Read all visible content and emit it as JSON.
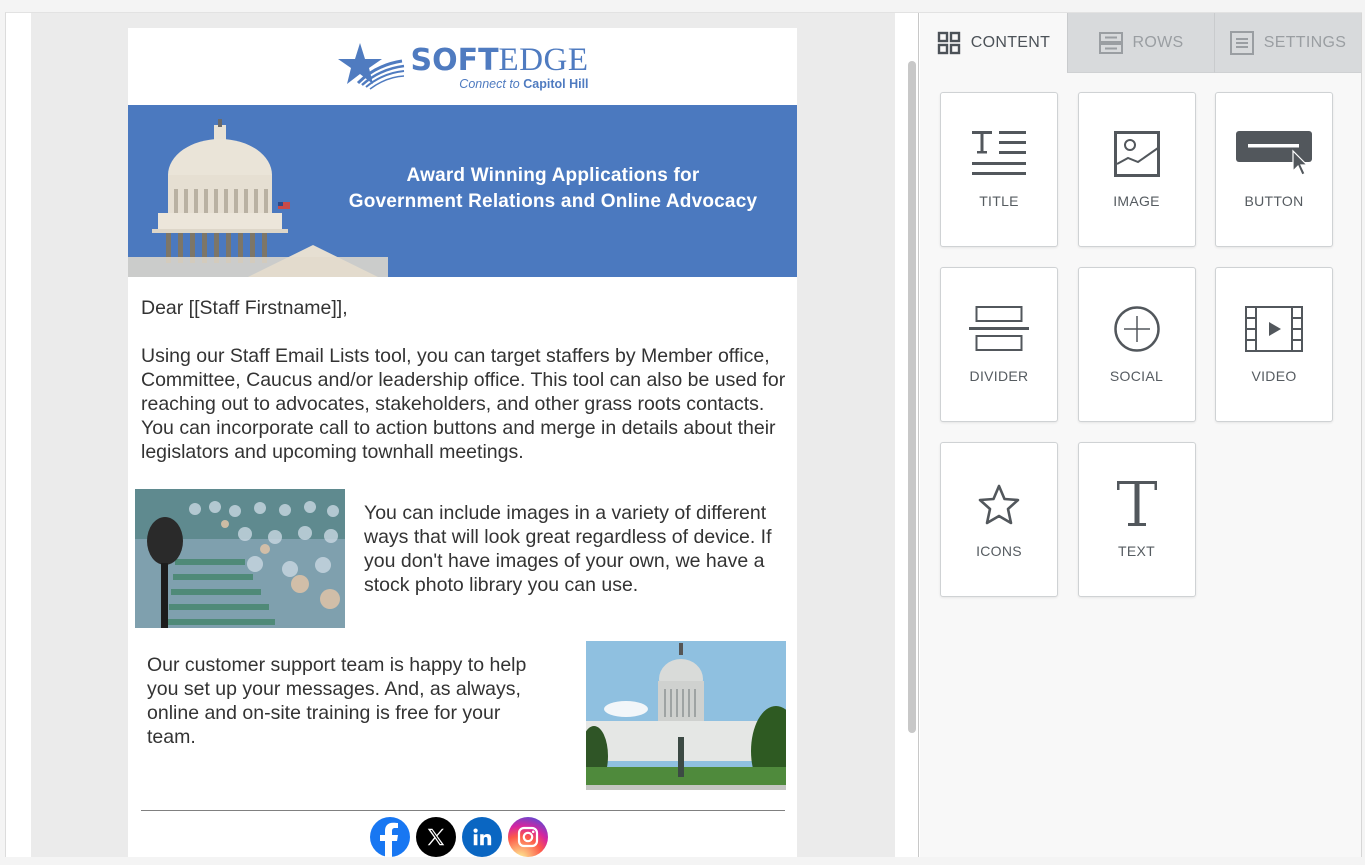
{
  "email": {
    "logo": {
      "brand_bold": "SOFT",
      "brand_light": "EDGE",
      "tagline_italic": "Connect to",
      "tagline_bold": "Capitol Hill"
    },
    "banner": {
      "line1": "Award Winning Applications for",
      "line2": "Government Relations and Online Advocacy"
    },
    "greeting": "Dear [[Staff Firstname]],",
    "paragraph1": "Using our Staff Email Lists tool, you can target staffers by Member office, Committee, Caucus and/or leadership office. This tool can also be used for reaching out to advocates, stakeholders, and other grass roots contacts. You can incorporate call to action buttons and merge in details about their legislators and upcoming townhall meetings.",
    "paragraph2": "You can include images in a variety of different ways that will look great regardless of device. If you don't have images of your own, we have a stock photo library you can use.",
    "paragraph3": "Our customer support team is happy to help you set up your messages. And, as always, online and on-site training is free for your team.",
    "social": [
      {
        "name": "facebook",
        "color": "#1877f2"
      },
      {
        "name": "x",
        "color": "#000000"
      },
      {
        "name": "linkedin",
        "color": "#0a66c2"
      },
      {
        "name": "instagram",
        "color": "#d6249f"
      }
    ]
  },
  "panel": {
    "tabs": [
      {
        "label": "CONTENT",
        "icon": "grid-icon",
        "active": true
      },
      {
        "label": "ROWS",
        "icon": "rows-icon",
        "active": false
      },
      {
        "label": "SETTINGS",
        "icon": "settings-icon",
        "active": false
      }
    ],
    "tiles": [
      {
        "label": "TITLE",
        "icon": "title-icon"
      },
      {
        "label": "IMAGE",
        "icon": "image-icon"
      },
      {
        "label": "BUTTON",
        "icon": "button-icon"
      },
      {
        "label": "DIVIDER",
        "icon": "divider-icon"
      },
      {
        "label": "SOCIAL",
        "icon": "social-icon"
      },
      {
        "label": "VIDEO",
        "icon": "video-icon"
      },
      {
        "label": "ICONS",
        "icon": "star-icon"
      },
      {
        "label": "TEXT",
        "icon": "text-icon"
      }
    ]
  },
  "colors": {
    "brand_blue": "#4f7bc0",
    "banner_blue": "#4b79bf",
    "icon_gray": "#52575c"
  }
}
